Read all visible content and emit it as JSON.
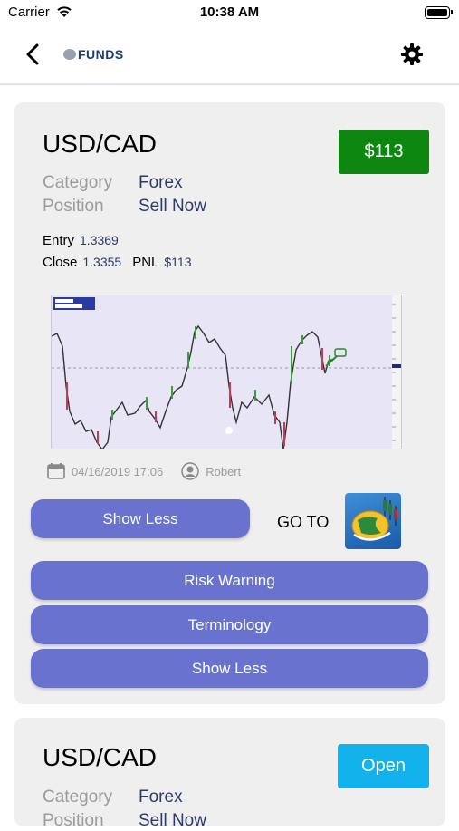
{
  "status_bar": {
    "carrier": "Carrier",
    "time": "10:38 AM"
  },
  "nav": {
    "logo_text": "FUNDS"
  },
  "card1": {
    "pair": "USD/CAD",
    "pnl_badge": "$113",
    "category_label": "Category",
    "category_value": "Forex",
    "position_label": "Position",
    "position_value": "Sell Now",
    "entry_label": "Entry",
    "entry_value": "1.3369",
    "close_label": "Close",
    "close_value": "1.3355",
    "pnl_label": "PNL",
    "pnl_value": "$113",
    "date": "04/16/2019 17:06",
    "author": "Robert",
    "show_less_small": "Show Less",
    "goto_label": "GO TO",
    "risk_warning": "Risk Warning",
    "terminology": "Terminology",
    "show_less": "Show Less"
  },
  "card2": {
    "pair": "USD/CAD",
    "open_button": "Open",
    "category_label": "Category",
    "category_value": "Forex",
    "position_label": "Position",
    "position_value": "Sell Now"
  },
  "colors": {
    "pnl_green": "#0d8710",
    "open_blue": "#12b3ec",
    "button_purple": "#6a72d0",
    "value_navy": "#2d3a6b",
    "label_gray": "#9b9b9b"
  }
}
